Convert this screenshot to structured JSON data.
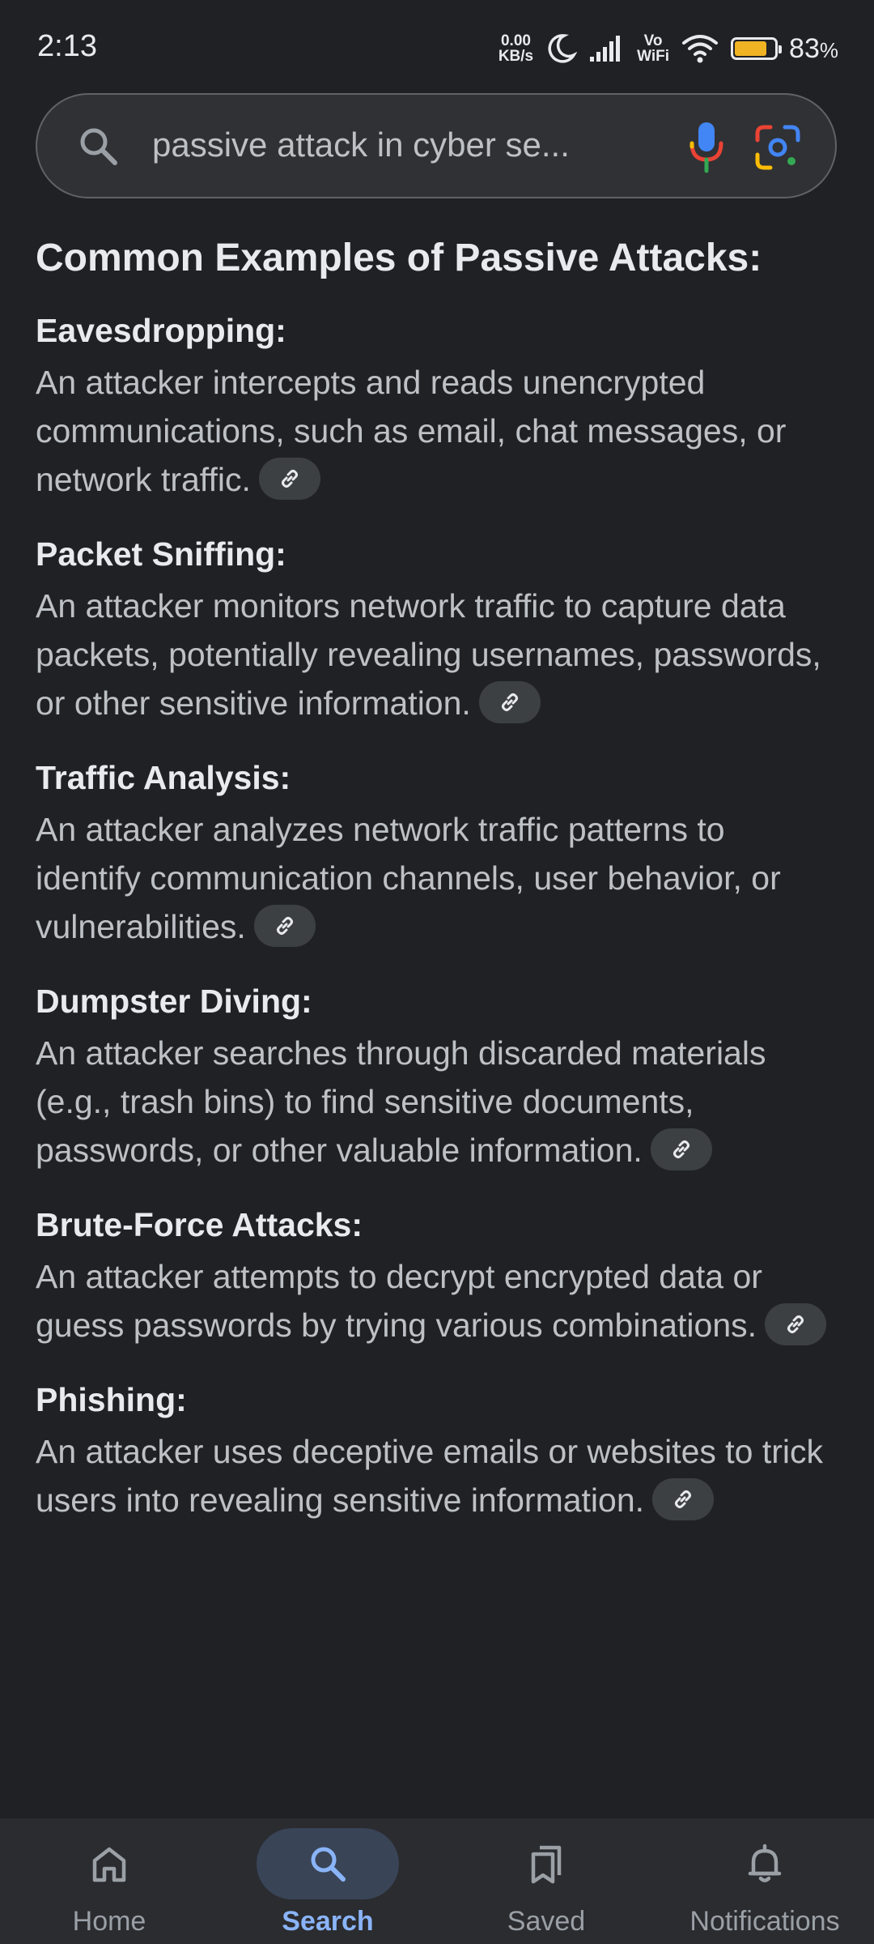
{
  "status_bar": {
    "time": "2:13",
    "net_speed_value": "0.00",
    "net_speed_unit": "KB/s",
    "vo_label": "Vo",
    "wifi_label": "WiFi",
    "battery_percent": "83",
    "battery_percent_sign": "%",
    "battery_level": 0.83,
    "battery_color": "#f0b323"
  },
  "search": {
    "query": "passive attack in cyber se..."
  },
  "content": {
    "section_title": "Common Examples of Passive Attacks:",
    "items": [
      {
        "heading": "Eavesdropping:",
        "body": "An attacker intercepts and reads unencrypted communications, such as email, chat messages, or network traffic."
      },
      {
        "heading": "Packet Sniffing:",
        "body": "An attacker monitors network traffic to capture data packets, potentially revealing usernames, passwords, or other sensitive information."
      },
      {
        "heading": "Traffic Analysis:",
        "body": "An attacker analyzes network traffic patterns to identify communication channels, user behavior, or vulnerabilities."
      },
      {
        "heading": "Dumpster Diving:",
        "body": "An attacker searches through discarded materials (e.g., trash bins) to find sensitive documents, passwords, or other valuable information."
      },
      {
        "heading": "Brute-Force Attacks:",
        "body": "An attacker attempts to decrypt encrypted data or guess passwords by trying various combinations."
      },
      {
        "heading": "Phishing:",
        "body": "An attacker uses deceptive emails or websites to trick users into revealing sensitive information."
      }
    ]
  },
  "bottom_nav": {
    "items": [
      {
        "label": "Home",
        "icon": "home-icon",
        "active": false
      },
      {
        "label": "Search",
        "icon": "search-icon",
        "active": true
      },
      {
        "label": "Saved",
        "icon": "bookmarks-icon",
        "active": false
      },
      {
        "label": "Notifications",
        "icon": "bell-icon",
        "active": false
      }
    ]
  },
  "colors": {
    "background": "#202124",
    "accent": "#8ab4f8",
    "active_pill": "#394457"
  }
}
